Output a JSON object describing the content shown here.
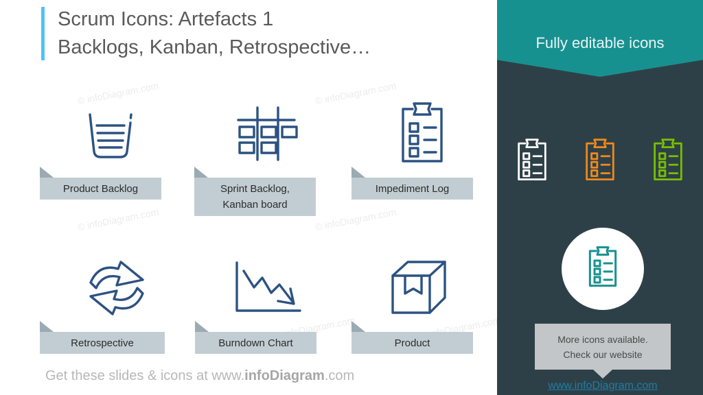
{
  "slide": {
    "title_line1": "Scrum Icons: Artefacts 1",
    "title_line2": "Backlogs, Kanban, Retrospective…",
    "footer_prefix": "Get these slides & icons at www.",
    "footer_brand": "infoDiagram",
    "footer_suffix": ".com",
    "watermark_text": "© infoDiagram.com"
  },
  "colors": {
    "accent_bar": "#4FC3F7",
    "icon_blue": "#2C5282",
    "banner_fill": "#C2CDD3",
    "banner_fold": "#9BAAB3",
    "panel_dark": "#2E4047",
    "panel_teal": "#179190",
    "link_blue": "#1B7EA8",
    "icon_white": "#FFFFFF",
    "icon_orange": "#F08A1C",
    "icon_green": "#79C000",
    "title_grey": "#5A5A5A",
    "footer_grey": "#B7B7B7"
  },
  "icons": [
    {
      "label": "Product Backlog",
      "label_line2": "",
      "icon": "basket-backlog-icon"
    },
    {
      "label": "Sprint Backlog,",
      "label_line2": "Kanban board",
      "icon": "kanban-board-icon"
    },
    {
      "label": "Impediment Log",
      "label_line2": "",
      "icon": "clipboard-checklist-icon"
    },
    {
      "label": "Retrospective",
      "label_line2": "",
      "icon": "recycle-arrows-icon"
    },
    {
      "label": "Burndown Chart",
      "label_line2": "",
      "icon": "burndown-chart-icon"
    },
    {
      "label": "Product",
      "label_line2": "",
      "icon": "package-box-icon"
    }
  ],
  "panel": {
    "banner_text": "Fully editable icons",
    "sample_icons": [
      {
        "name": "clipboard-checklist-icon-white",
        "color": "#FFFFFF"
      },
      {
        "name": "clipboard-checklist-icon-orange",
        "color": "#F08A1C"
      },
      {
        "name": "clipboard-checklist-icon-green",
        "color": "#79C000"
      }
    ],
    "badge_icon": "clipboard-checklist-icon-teal",
    "badge_icon_color": "#179190",
    "cta_line1": "More icons available.",
    "cta_line2": "Check our website",
    "cta_link": "www.infoDiagram.com"
  }
}
